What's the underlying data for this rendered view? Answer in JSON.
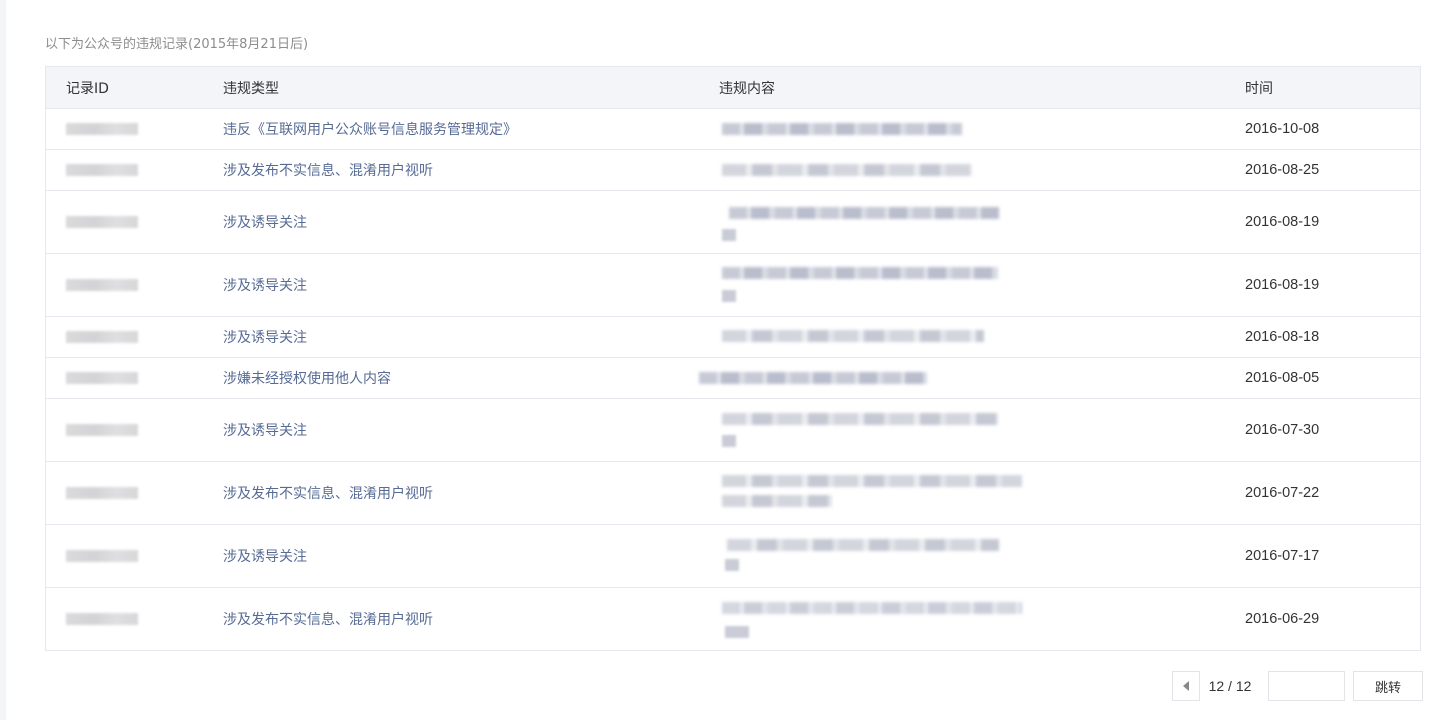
{
  "intro_text": "以下为公众号的违规记录(2015年8月21日后)",
  "table": {
    "headers": {
      "id": "记录ID",
      "type": "违规类型",
      "content": "违规内容",
      "time": "时间"
    },
    "rows": [
      {
        "type": "违反《互联网用户公众账号信息服务管理规定》",
        "time": "2016-10-08"
      },
      {
        "type": "涉及发布不实信息、混淆用户视听",
        "time": "2016-08-25"
      },
      {
        "type": "涉及诱导关注",
        "time": "2016-08-19"
      },
      {
        "type": "涉及诱导关注",
        "time": "2016-08-19"
      },
      {
        "type": "涉及诱导关注",
        "time": "2016-08-18"
      },
      {
        "type": "涉嫌未经授权使用他人内容",
        "time": "2016-08-05"
      },
      {
        "type": "涉及诱导关注",
        "time": "2016-07-30"
      },
      {
        "type": "涉及发布不实信息、混淆用户视听",
        "time": "2016-07-22"
      },
      {
        "type": "涉及诱导关注",
        "time": "2016-07-17"
      },
      {
        "type": "涉及发布不实信息、混淆用户视听",
        "time": "2016-06-29"
      }
    ]
  },
  "pager": {
    "page_label": "12 / 12",
    "input_value": "",
    "jump_label": "跳转",
    "prev_icon": "chevron-left-icon"
  }
}
